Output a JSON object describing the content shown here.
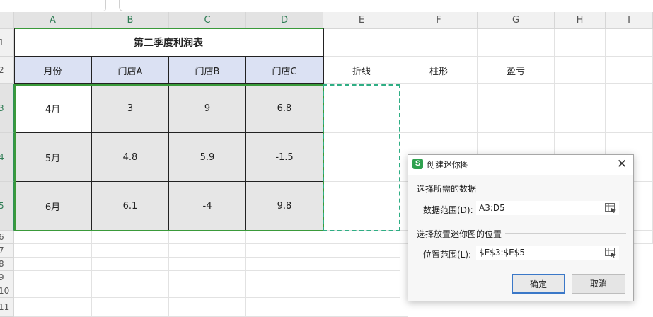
{
  "columns": [
    "A",
    "B",
    "C",
    "D",
    "E",
    "F",
    "G",
    "H",
    "I"
  ],
  "rows": [
    "1",
    "2",
    "3",
    "4",
    "5",
    "6",
    "7",
    "8",
    "9",
    "10",
    "11"
  ],
  "table": {
    "title": "第二季度利润表",
    "headers": [
      "月份",
      "门店A",
      "门店B",
      "门店C"
    ],
    "data": [
      [
        "4月",
        "3",
        "9",
        "6.8"
      ],
      [
        "5月",
        "4.8",
        "5.9",
        "-1.5"
      ],
      [
        "6月",
        "6.1",
        "-4",
        "9.8"
      ]
    ]
  },
  "extra_headers": [
    "折线",
    "柱形",
    "盈亏"
  ],
  "dialog": {
    "title": "创建迷你图",
    "app_icon_letter": "S",
    "close_glyph": "✕",
    "section1": "选择所需的数据",
    "data_range_label": "数据范围(D):",
    "data_range_value": "A3:D5",
    "section2": "选择放置迷你图的位置",
    "location_range_label": "位置范围(L):",
    "location_range_value": "$E$3:$E$5",
    "ok_label": "确定",
    "cancel_label": "取消"
  },
  "colors": {
    "header_fill": "#dbe1f3",
    "data_fill": "#e6e6e6",
    "selection_border": "#3a9a3a",
    "target_dash": "#2fae84",
    "app_icon": "#2ea14f",
    "ok_button_border": "#3b78c8"
  }
}
